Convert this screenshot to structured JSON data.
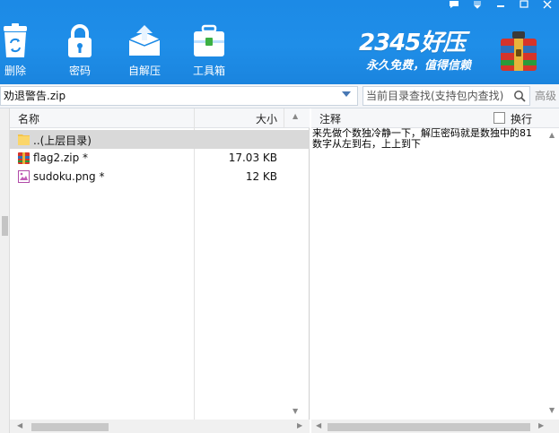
{
  "toolbar": {
    "delete_label": "删除",
    "password_label": "密码",
    "selfextract_label": "自解压",
    "toolbox_label": "工具箱"
  },
  "brand": {
    "logo": "2345好压",
    "slogan": "永久免费，值得信赖"
  },
  "address": {
    "path": "劝退警告.zip",
    "search_placeholder": "当前目录查找(支持包内查找)",
    "advanced_label": "高级"
  },
  "list": {
    "col_name": "名称",
    "col_size": "大小",
    "rows": [
      {
        "name": "..(上层目录)",
        "size": "",
        "icon": "folder-icon"
      },
      {
        "name": "flag2.zip *",
        "size": "17.03 KB",
        "icon": "zip-archive-icon"
      },
      {
        "name": "sudoku.png *",
        "size": "12 KB",
        "icon": "image-file-icon"
      }
    ]
  },
  "notes": {
    "title": "注释",
    "wrap_label": "换行",
    "text": "来先做个数独冷静一下，解压密码就是数独中的81\n数字从左到右，上上到下"
  },
  "colors": {
    "toolbar_blue": "#1c8ae6",
    "selection_gray": "#d9d9d9",
    "accent_blue": "#4878b4"
  }
}
